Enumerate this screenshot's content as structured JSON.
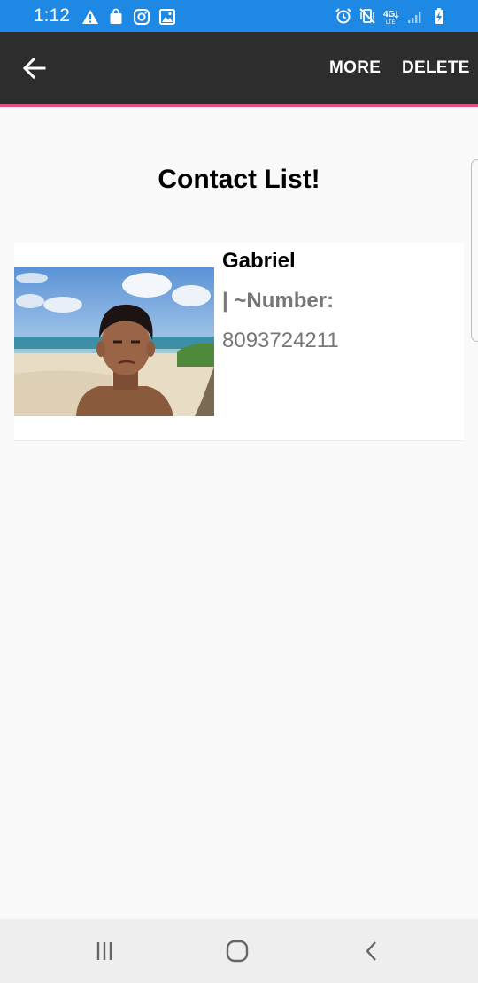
{
  "status_bar": {
    "time": "1:12",
    "color": "#1e88e5",
    "left_icons": [
      "warning-icon",
      "shopping-bag-icon",
      "instagram-icon",
      "gallery-icon"
    ],
    "right_icons": [
      "alarm-icon",
      "vibrate-mute-icon",
      "4g-lte-icon",
      "signal-icon",
      "battery-charging-icon"
    ],
    "network_label": "4G"
  },
  "app_bar": {
    "background": "#2d2d2d",
    "accent_color": "#e84c7f",
    "back_icon": "arrow-back-icon",
    "more_label": "MORE",
    "delete_label": "DELETE"
  },
  "main": {
    "title": "Contact List!",
    "contacts": [
      {
        "name": "Gabriel",
        "number_label": "| ~Number:",
        "number": "8093724211",
        "photo": "beach-selfie-photo"
      }
    ]
  },
  "nav_bar": {
    "buttons": [
      "recents-icon",
      "home-icon",
      "back-icon"
    ]
  }
}
